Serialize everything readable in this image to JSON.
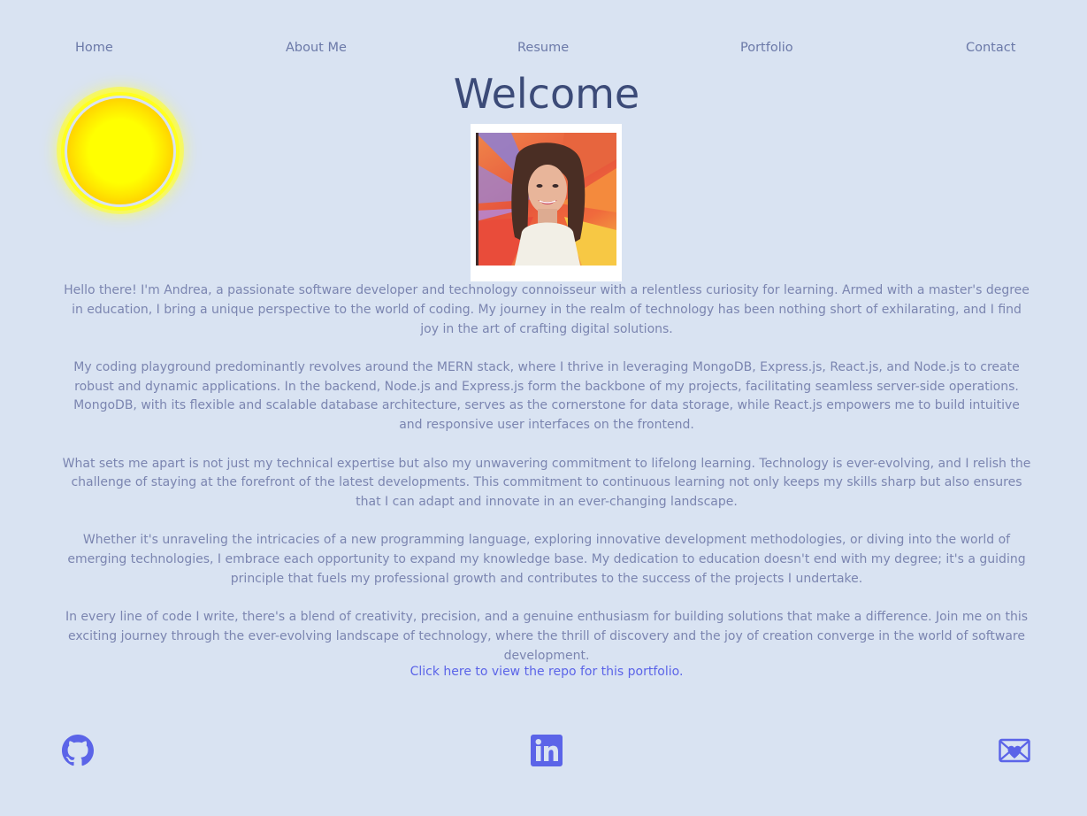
{
  "nav": {
    "items": [
      {
        "label": "Home"
      },
      {
        "label": "About Me"
      },
      {
        "label": "Resume"
      },
      {
        "label": "Portfolio"
      },
      {
        "label": "Contact"
      }
    ]
  },
  "theme": {
    "icon": "sun-icon",
    "sun_color": "#ffff00"
  },
  "page": {
    "title": "Welcome"
  },
  "profile": {
    "photo_icon": "profile-photo"
  },
  "bio": {
    "paragraphs": [
      "Hello there! I'm Andrea, a passionate software developer and technology connoisseur with a relentless curiosity for learning. Armed with a master's degree in education, I bring a unique perspective to the world of coding. My journey in the realm of technology has been nothing short of exhilarating, and I find joy in the art of crafting digital solutions.",
      "My coding playground predominantly revolves around the MERN stack, where I thrive in leveraging MongoDB, Express.js, React.js, and Node.js to create robust and dynamic applications. In the backend, Node.js and Express.js form the backbone of my projects, facilitating seamless server-side operations. MongoDB, with its flexible and scalable database architecture, serves as the cornerstone for data storage, while React.js empowers me to build intuitive and responsive user interfaces on the frontend.",
      "What sets me apart is not just my technical expertise but also my unwavering commitment to lifelong learning. Technology is ever-evolving, and I relish the challenge of staying at the forefront of the latest developments. This commitment to continuous learning not only keeps my skills sharp but also ensures that I can adapt and innovate in an ever-changing landscape.",
      "Whether it's unraveling the intricacies of a new programming language, exploring innovative development methodologies, or diving into the world of emerging technologies, I embrace each opportunity to expand my knowledge base. My dedication to education doesn't end with my degree; it's a guiding principle that fuels my professional growth and contributes to the success of the projects I undertake.",
      "In every line of code I write, there's a blend of creativity, precision, and a genuine enthusiasm for building solutions that make a difference. Join me on this exciting journey through the ever-evolving landscape of technology, where the thrill of discovery and the joy of creation converge in the world of software development."
    ],
    "repo_link": "Click here to view the repo for this portfolio."
  },
  "social": {
    "icons": [
      "github-icon",
      "linkedin-icon",
      "email-heart-icon"
    ],
    "color": "#5b64e8"
  },
  "colors": {
    "background": "#d9e3f2",
    "nav_text": "#6b79a8",
    "title": "#3c4b78",
    "body_text": "#7b85b0",
    "link": "#5b64e8"
  }
}
